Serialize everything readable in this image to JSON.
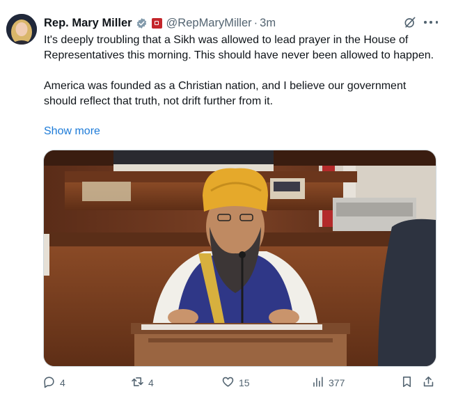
{
  "author": {
    "name": "Rep. Mary Miller",
    "handle": "@RepMaryMiller",
    "separator": "·",
    "time": "3m"
  },
  "tweet": {
    "paragraph1": "It's deeply troubling that a Sikh was allowed to lead prayer in the House of Representatives this morning. This should have never been allowed to happen.",
    "paragraph2": "America was founded as a Christian nation, and I believe our government should reflect that truth, not drift further from it.",
    "show_more": "Show more"
  },
  "icons": {
    "verified": "verified-badge-icon",
    "gov": "government-badge-icon",
    "grok": "grok-icon",
    "more": "more-icon",
    "reply": "reply-icon",
    "retweet": "retweet-icon",
    "like": "heart-icon",
    "views": "views-icon",
    "bookmark": "bookmark-icon",
    "share": "share-icon"
  },
  "stats": {
    "replies": "4",
    "retweets": "4",
    "likes": "15",
    "views": "377"
  },
  "colors": {
    "link": "#1d7bd8",
    "muted": "#536471",
    "verified": "#829aab",
    "gov_badge": "#c4262b"
  }
}
